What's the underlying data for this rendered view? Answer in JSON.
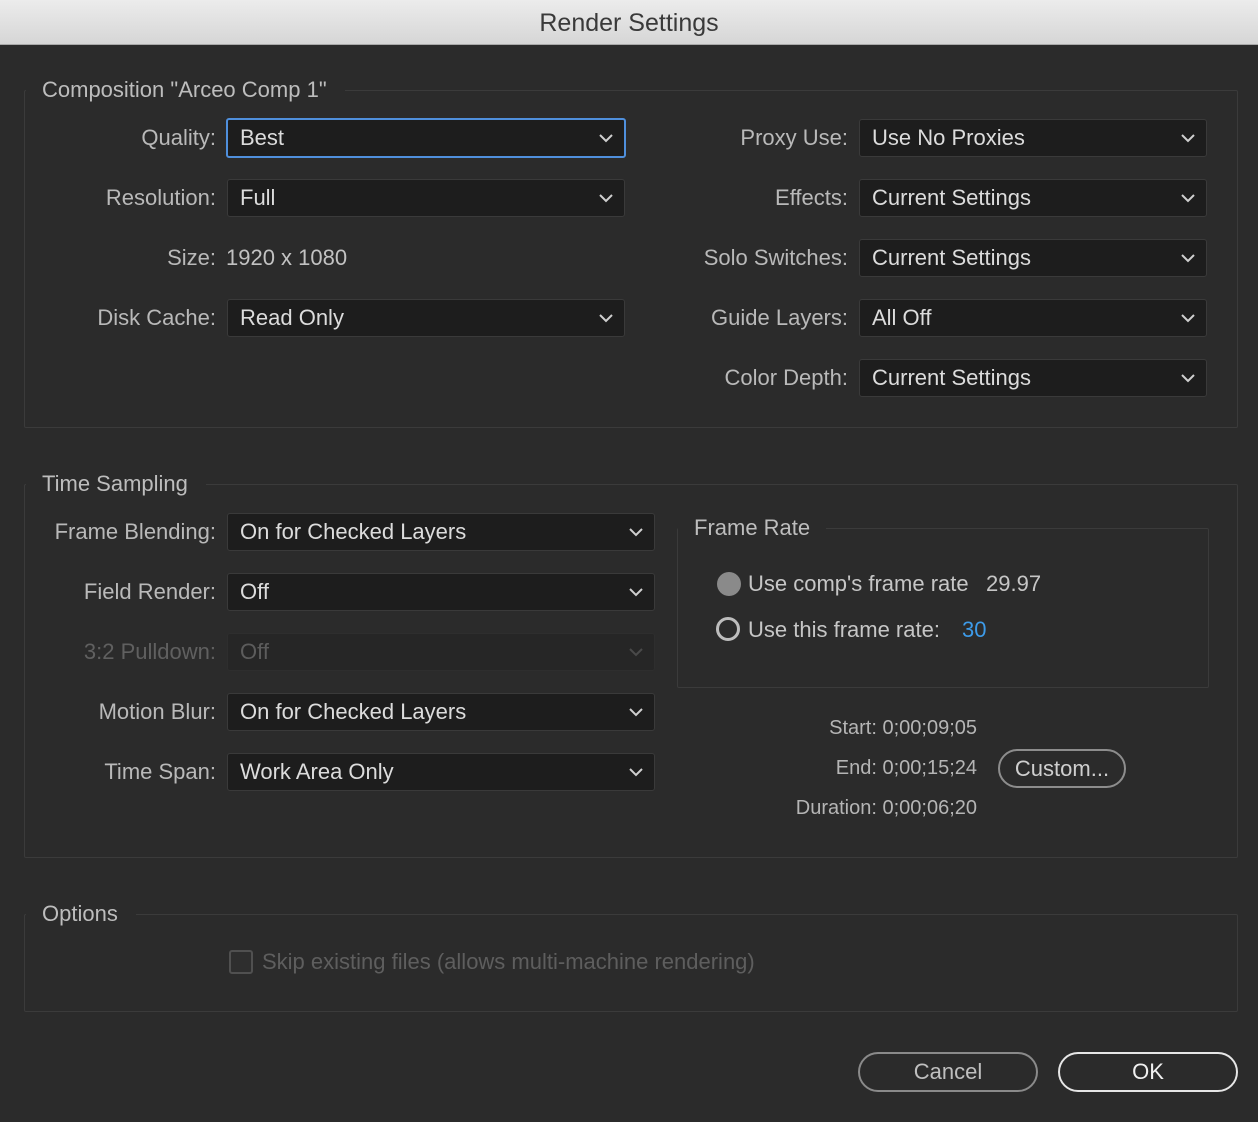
{
  "window": {
    "title": "Render Settings"
  },
  "composition": {
    "legend": "Composition \"Arceo Comp 1\"",
    "quality": {
      "label": "Quality:",
      "value": "Best"
    },
    "resolution": {
      "label": "Resolution:",
      "value": "Full"
    },
    "size": {
      "label": "Size:",
      "value": "1920 x 1080"
    },
    "disk_cache": {
      "label": "Disk Cache:",
      "value": "Read Only"
    },
    "proxy_use": {
      "label": "Proxy Use:",
      "value": "Use No Proxies"
    },
    "effects": {
      "label": "Effects:",
      "value": "Current Settings"
    },
    "solo_switches": {
      "label": "Solo Switches:",
      "value": "Current Settings"
    },
    "guide_layers": {
      "label": "Guide Layers:",
      "value": "All Off"
    },
    "color_depth": {
      "label": "Color Depth:",
      "value": "Current Settings"
    }
  },
  "time_sampling": {
    "legend": "Time Sampling",
    "frame_blending": {
      "label": "Frame Blending:",
      "value": "On for Checked Layers"
    },
    "field_render": {
      "label": "Field Render:",
      "value": "Off"
    },
    "pulldown": {
      "label": "3:2 Pulldown:",
      "value": "Off"
    },
    "motion_blur": {
      "label": "Motion Blur:",
      "value": "On for Checked Layers"
    },
    "time_span": {
      "label": "Time Span:",
      "value": "Work Area Only"
    },
    "frame_rate": {
      "legend": "Frame Rate",
      "use_comp": {
        "label": "Use comp's frame rate",
        "value": "29.97"
      },
      "use_this": {
        "label": "Use this frame rate:",
        "value": "30"
      }
    },
    "start": {
      "label": "Start:",
      "value": "0;00;09;05"
    },
    "end": {
      "label": "End:",
      "value": "0;00;15;24"
    },
    "duration": {
      "label": "Duration:",
      "value": "0;00;06;20"
    },
    "custom_button": "Custom..."
  },
  "options": {
    "legend": "Options",
    "skip_existing": "Skip existing files (allows multi-machine rendering)"
  },
  "buttons": {
    "cancel": "Cancel",
    "ok": "OK"
  },
  "colors": {
    "accent": "#4f8fdc",
    "link_value": "#3d9be9"
  },
  "icons": {
    "dropdown": "chevron-down-icon"
  }
}
